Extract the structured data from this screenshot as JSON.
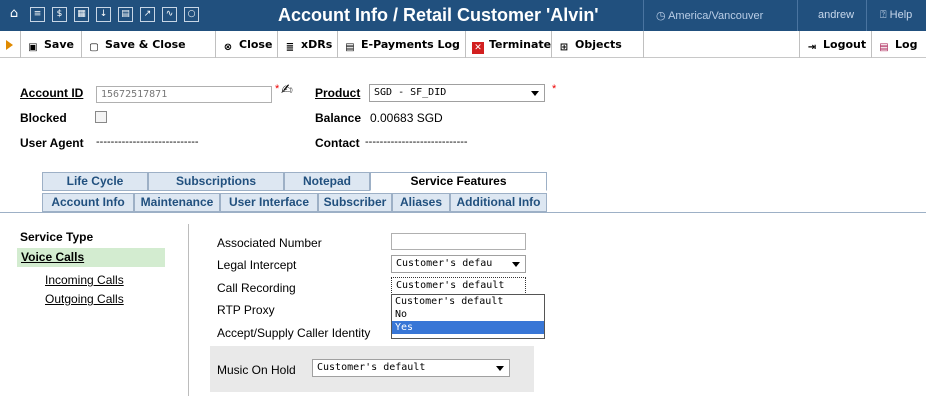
{
  "titlebar": {
    "title": "Account Info / Retail Customer 'Alvin'",
    "timezone": "America/Vancouver",
    "user": "andrew",
    "help": "Help"
  },
  "toolbar": {
    "save": "Save",
    "save_close": "Save & Close",
    "close": "Close",
    "xdrs": "xDRs",
    "epayments": "E-Payments Log",
    "terminate": "Terminate",
    "objects": "Objects",
    "logout": "Logout",
    "log": "Log"
  },
  "header": {
    "account_id_label": "Account ID",
    "account_id_value": "15672517871",
    "req_mark": "*",
    "product_label": "Product",
    "product_value": "SGD - SF_DID",
    "blocked_label": "Blocked",
    "balance_label": "Balance",
    "balance_value": "0.00683 SGD",
    "user_agent_label": "User Agent",
    "user_agent_value": "----------------------------",
    "contact_label": "Contact",
    "contact_value": "----------------------------"
  },
  "tabs": {
    "row1": [
      "Life Cycle",
      "Subscriptions",
      "Notepad",
      "Service Features"
    ],
    "row2": [
      "Account Info",
      "Maintenance",
      "User Interface",
      "Subscriber",
      "Aliases",
      "Additional Info"
    ]
  },
  "sidebar": {
    "heading": "Service Type",
    "active": "Voice Calls",
    "items": [
      "Incoming Calls",
      "Outgoing Calls"
    ]
  },
  "features": {
    "associated_number": "Associated Number",
    "legal_intercept": "Legal Intercept",
    "legal_intercept_value": "Customer's defau",
    "call_recording": "Call Recording",
    "call_recording_value": "Customer's default",
    "rtp_proxy": "RTP Proxy",
    "caller_identity": "Accept/Supply Caller Identity",
    "dropdown_options": [
      "Customer's default",
      "No",
      "Yes"
    ],
    "music_on_hold": "Music On Hold",
    "music_on_hold_value": "Customer's default"
  },
  "colors": {
    "titlebar": "#21507e",
    "tab_bg": "#dde7f2",
    "nav_active": "#d3ecd0",
    "dropdown_selected": "#3876d6"
  }
}
